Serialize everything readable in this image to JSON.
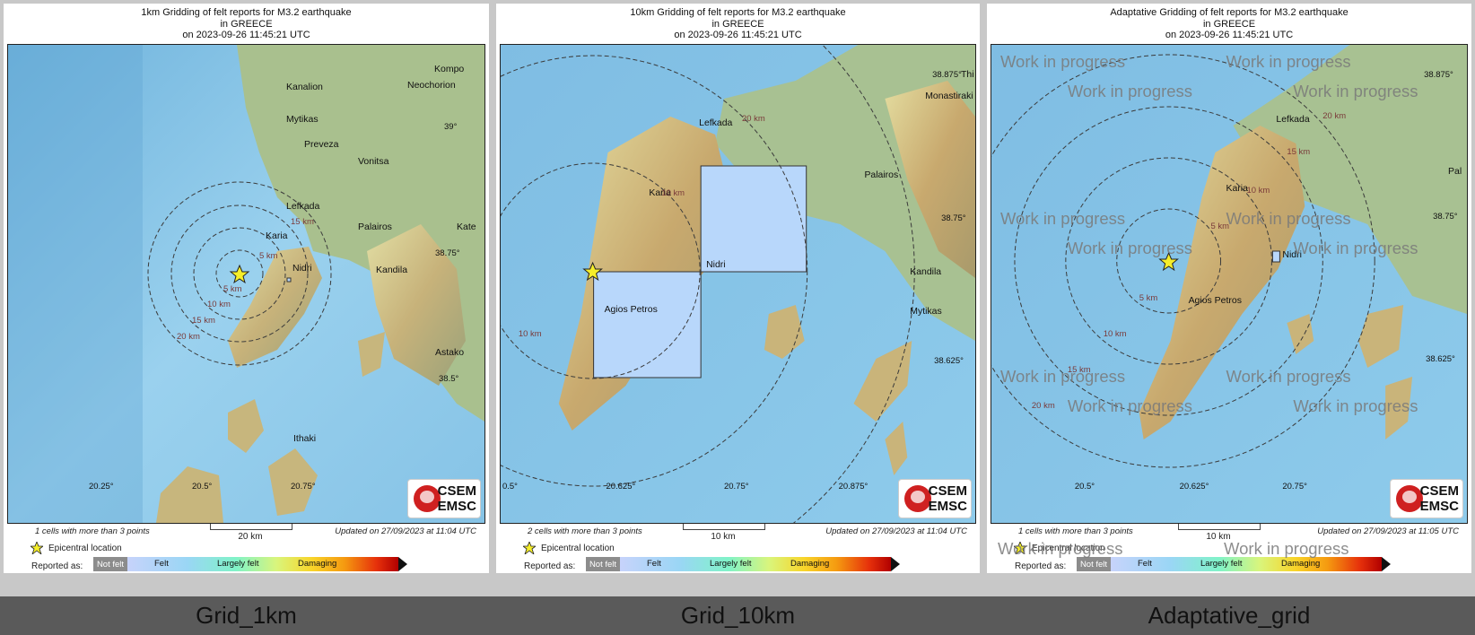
{
  "panels": [
    {
      "caption": "Grid_1km",
      "title_line1": "1km Gridding of felt reports for M3.2 earthquake",
      "title_line2": "in GREECE",
      "title_line3": "on  2023-09-26 11:45:21 UTC",
      "cells_note": "1 cells with more than 3 points",
      "updated": "Updated on 27/09/2023 at 11:04 UTC",
      "scale_label": "20 km",
      "places": [
        "Kompo",
        "Kanalion",
        "Neochorion",
        "Mytikas",
        "Preveza",
        "Vonitsa",
        "Lefkada",
        "Karia",
        "Nidri",
        "Palairos",
        "Kate",
        "Kandila",
        "Astako",
        "Ithaki"
      ],
      "lat_labels": [
        "39°",
        "38.75°",
        "38.5°"
      ],
      "lon_labels": [
        "20.25°",
        "20.5°",
        "20.75°"
      ],
      "ring_labels": [
        "5 km",
        "10 km",
        "15 km",
        "20 km",
        "5 km",
        "15 km"
      ]
    },
    {
      "caption": "Grid_10km",
      "title_line1": "10km Gridding of felt reports for M3.2 earthquake",
      "title_line2": "in GREECE",
      "title_line3": "on  2023-09-26 11:45:21 UTC",
      "cells_note": "2 cells with more than 3 points",
      "updated": "Updated on 27/09/2023 at 11:04 UTC",
      "scale_label": "10 km",
      "places": [
        "Thi",
        "Monastiraki",
        "Lefkada",
        "Karia",
        "Palairos",
        "Nidri",
        "Agios Petros",
        "Kandila",
        "Mytikas"
      ],
      "lat_labels": [
        "38.875°",
        "38.75°",
        "38.625°"
      ],
      "lon_labels": [
        "0.5°",
        "20.625°",
        "20.75°",
        "20.875°"
      ],
      "ring_labels": [
        "10 km",
        "20 km",
        "10 km"
      ]
    },
    {
      "caption": "Adaptative_grid",
      "title_line1": "Adaptative Gridding of felt reports for M3.2 earthquake",
      "title_line2": "in GREECE",
      "title_line3": "on  2023-09-26 11:45:21 UTC",
      "cells_note": "1 cells with more than 3 points",
      "updated": "Updated on 27/09/2023 at 11:05 UTC",
      "scale_label": "10 km",
      "places": [
        "Lefkada",
        "Pal",
        "Karia",
        "Nidri",
        "Agios Petros"
      ],
      "lat_labels": [
        "38.875°",
        "38.75°",
        "38.625°"
      ],
      "lon_labels": [
        "20.5°",
        "20.625°",
        "20.75°"
      ],
      "ring_labels": [
        "5 km",
        "10 km",
        "15 km",
        "20 km",
        "5 km",
        "10 km",
        "15 km",
        "20 km"
      ],
      "watermark": "Work in progress"
    }
  ],
  "legend": {
    "epicentral": "Epicentral location",
    "reported_as": "Reported as:",
    "not_felt": "Not felt",
    "felt": "Felt",
    "largely_felt": "Largely felt",
    "damaging": "Damaging"
  },
  "logo": {
    "line1": "CSEM",
    "line2": "EMSC"
  },
  "colors": {
    "sea": "#8fc7e6",
    "land": "#c9c28a",
    "cell_fill": "#b8d7fb",
    "ring": "#3b3b3b",
    "epicenter": "#f5ee2a"
  }
}
